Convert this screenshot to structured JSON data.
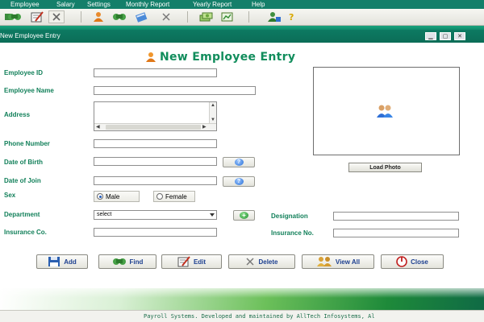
{
  "menu": {
    "employee": "Employee",
    "salary": "Salary",
    "settings": "Settings",
    "monthly_report": "Monthly Report",
    "yearly_report": "Yearly Report",
    "help": "Help"
  },
  "window": {
    "title": "New Employee Entry"
  },
  "form": {
    "heading": "New Employee Entry",
    "employee_id_label": "Employee ID",
    "employee_id_value": "",
    "employee_name_label": "Employee Name",
    "employee_name_value": "",
    "address_label": "Address",
    "address_value": "",
    "phone_label": "Phone Number",
    "phone_value": "",
    "dob_label": "Date of Birth",
    "dob_value": "",
    "doj_label": "Date of Join",
    "doj_value": "",
    "sex_label": "Sex",
    "sex_male": "Male",
    "sex_female": "Female",
    "sex_selected": "Male",
    "department_label": "Department",
    "department_selected": "select",
    "designation_label": "Designation",
    "designation_value": "",
    "insurance_co_label": "Insurance Co.",
    "insurance_co_value": "",
    "insurance_no_label": "Insurance No.",
    "insurance_no_value": "",
    "load_photo": "Load Photo"
  },
  "actions": {
    "add": "Add",
    "find": "Find",
    "edit": "Edit",
    "delete": "Delete",
    "view_all": "View All",
    "close": "Close"
  },
  "status": {
    "text": "Payroll Systems. Developed and maintained by AllTech Infosystems, Al"
  },
  "colors": {
    "brand_green": "#147f6a",
    "label_green": "#12805a",
    "button_text": "#1c3f8f"
  }
}
